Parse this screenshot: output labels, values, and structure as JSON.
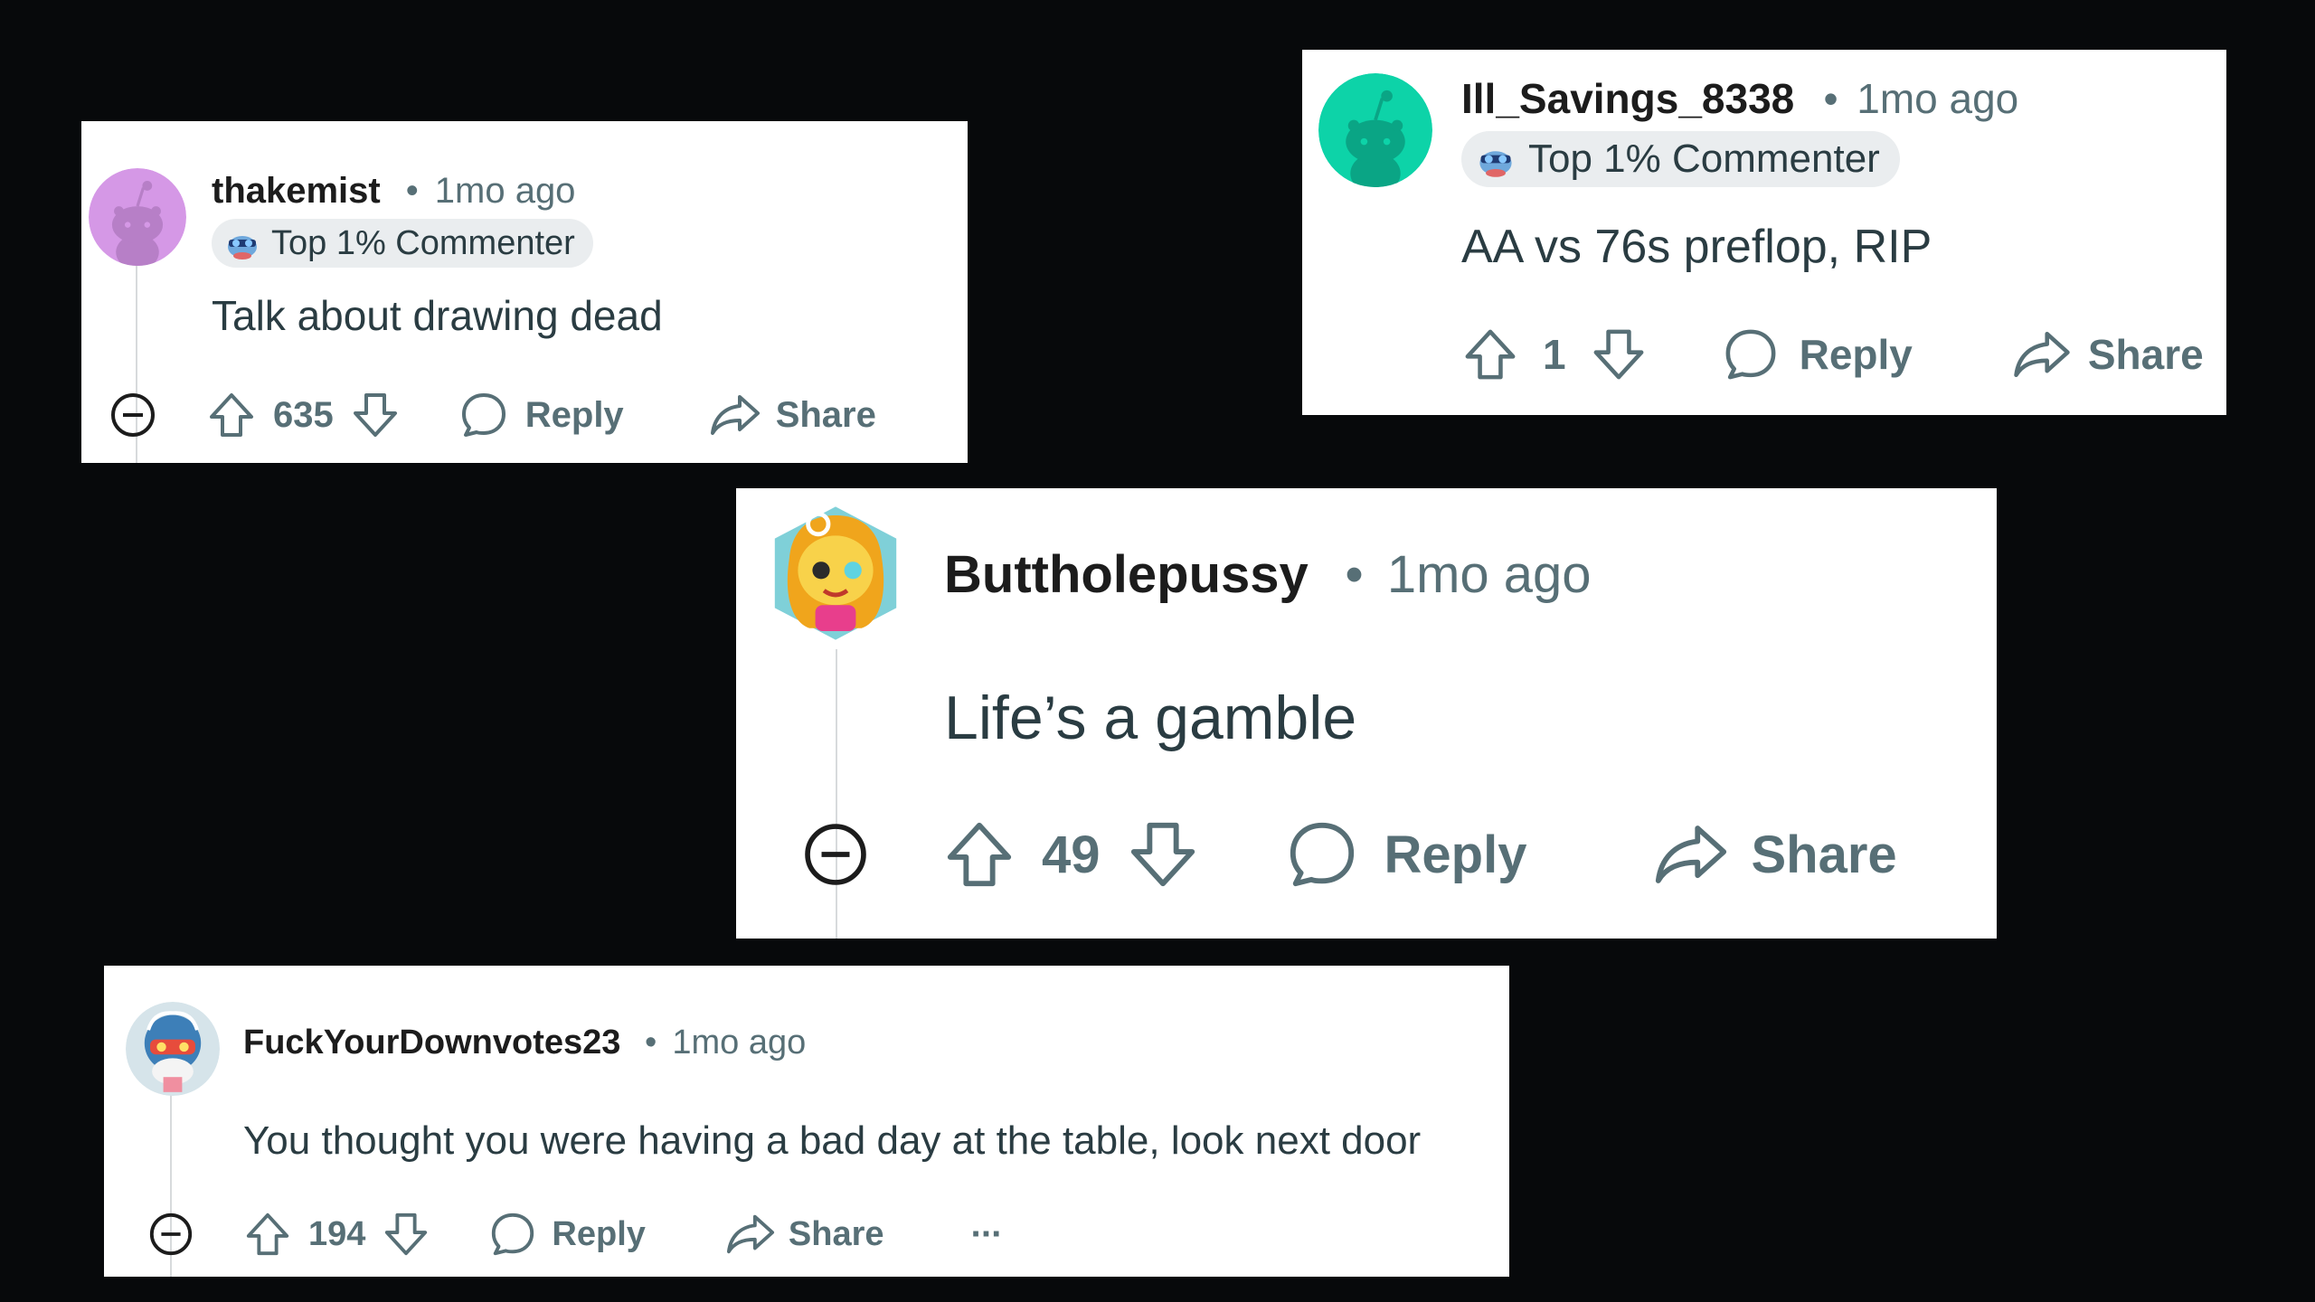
{
  "comments": [
    {
      "username": "thakemist",
      "time": "1mo ago",
      "separator": "•",
      "flair": "Top 1% Commenter",
      "text": "Talk about drawing dead",
      "votes": "635",
      "reply_label": "Reply",
      "share_label": "Share",
      "avatar_color": "#d598e6"
    },
    {
      "username": "Ill_Savings_8338",
      "time": "1mo ago",
      "separator": "•",
      "flair": "Top 1% Commenter",
      "text": "AA vs 76s preflop, RIP",
      "votes": "1",
      "reply_label": "Reply",
      "share_label": "Share",
      "avatar_color": "#0dd3a8"
    },
    {
      "username": "Buttholepussy",
      "time": "1mo ago",
      "separator": "•",
      "text": "Life’s a gamble",
      "votes": "49",
      "reply_label": "Reply",
      "share_label": "Share"
    },
    {
      "username": "FuckYourDownvotes23",
      "time": "1mo ago",
      "separator": "•",
      "text": "You thought you were having a bad day at the table, look next door",
      "votes": "194",
      "reply_label": "Reply",
      "share_label": "Share",
      "more_label": "···"
    }
  ],
  "colors": {
    "background": "#07090b",
    "card": "#ffffff",
    "muted": "#576f76",
    "text": "#2a3c42",
    "flair_bg": "#eaedef"
  }
}
